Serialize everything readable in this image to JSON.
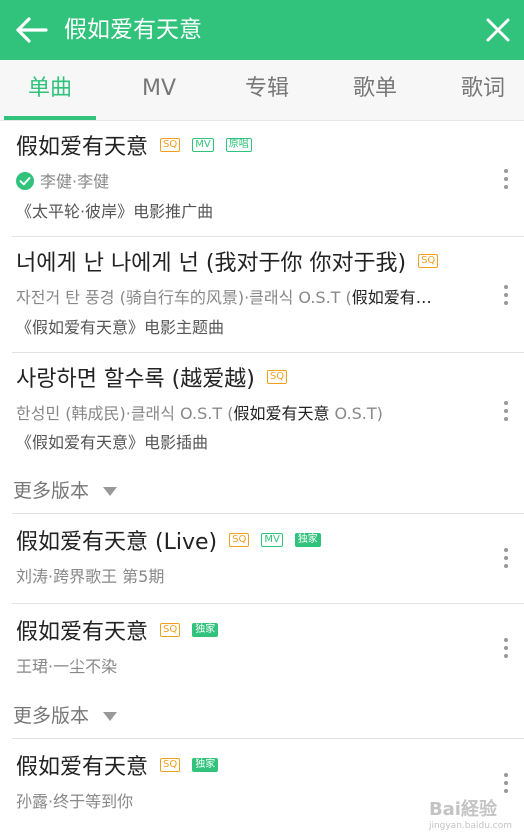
{
  "header": {
    "query": "假如爱有天意"
  },
  "tabs": [
    "单曲",
    "MV",
    "专辑",
    "歌单",
    "歌词"
  ],
  "colors": {
    "accent": "#31c27c",
    "sq": "#f0a020"
  },
  "songs": [
    {
      "title": "假如爱有天意",
      "badges": [
        "SQ",
        "MV",
        "原唱"
      ],
      "sub": "李健·李健",
      "desc": "《太平轮·彼岸》电影推广曲"
    },
    {
      "title": "너에게 난 나에게 넌 (我对于你 你对于我)",
      "badges": [
        "SQ"
      ],
      "sub_pre": "자전거 탄 풍경 (骑自行车的风景)·클래식 O.S.T (",
      "sub_hl": "假如爱有…",
      "desc": "《假如爱有天意》电影主题曲"
    },
    {
      "title": "사랑하면 할수록 (越爱越)",
      "badges": [
        "SQ"
      ],
      "sub_pre": "한성민 (韩成民)·클래식 O.S.T (",
      "sub_hl": "假如爱有天意",
      "sub_post": " O.S.T)",
      "desc": "《假如爱有天意》电影插曲"
    },
    {
      "title": "假如爱有天意 (Live)",
      "badges": [
        "SQ",
        "MV",
        "独家"
      ],
      "sub": "刘涛·跨界歌王 第5期"
    },
    {
      "title": "假如爱有天意",
      "badges": [
        "SQ",
        "独家"
      ],
      "sub": "王珺·一尘不染"
    },
    {
      "title": "假如爱有天意",
      "badges": [
        "SQ",
        "独家"
      ],
      "sub": "孙露·终于等到你"
    }
  ],
  "more_versions_label": "更多版本",
  "watermark": {
    "main": "Bai経验",
    "sub": "jingyan.baidu.com"
  }
}
